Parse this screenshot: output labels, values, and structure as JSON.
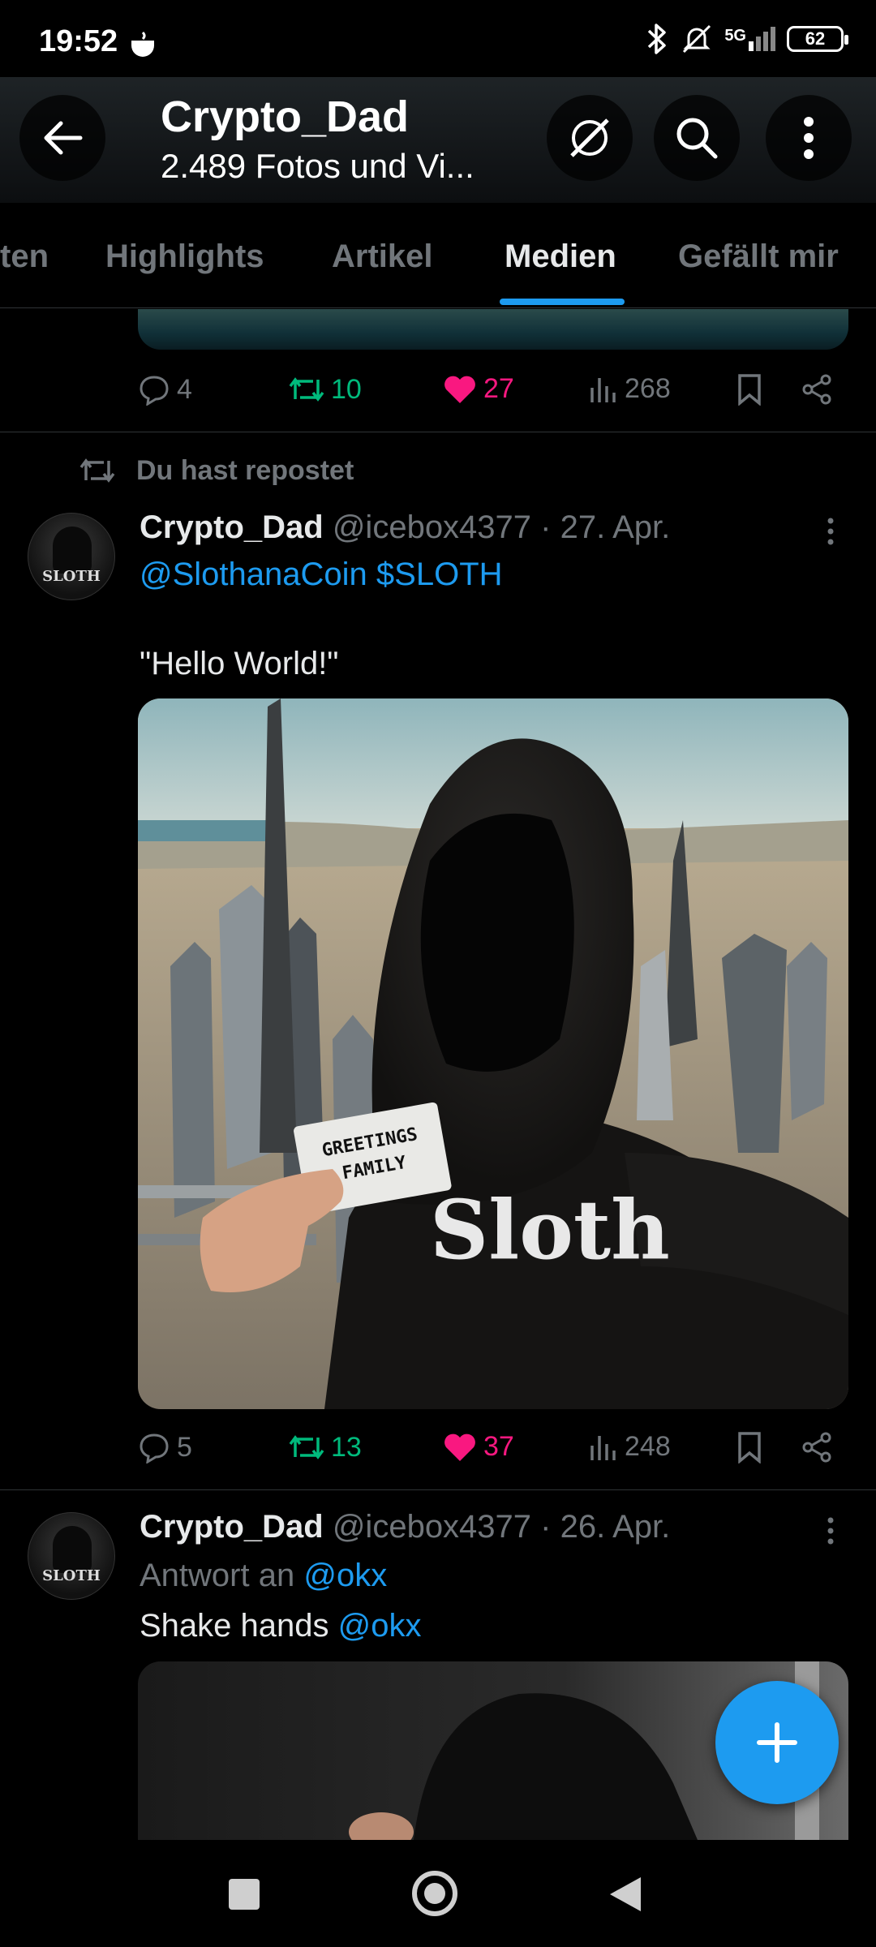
{
  "status_bar": {
    "time": "19:52",
    "network": "5G",
    "battery": "62",
    "icons": [
      "coffee-icon",
      "bluetooth-icon",
      "mute-bell-icon",
      "signal-icon",
      "battery-icon"
    ]
  },
  "header": {
    "profile_name": "Crypto_Dad",
    "subtitle": "2.489 Fotos und Vi...",
    "icons": [
      "back-arrow-icon",
      "grok-icon",
      "search-icon",
      "more-vertical-icon"
    ]
  },
  "tabs": {
    "items": [
      "ten",
      "Highlights",
      "Artikel",
      "Medien",
      "Gefällt mir"
    ],
    "active": "Medien"
  },
  "tweet0": {
    "replies": "4",
    "retweets": "10",
    "likes": "27",
    "views": "268"
  },
  "tweet1": {
    "repost_label": "Du hast repostet",
    "name": "Crypto_Dad",
    "meta": "@icebox4377 · 27. Apr.",
    "mention": "@SlothanaCoin",
    "cashtag": "$SLOTH",
    "text": "\"Hello World!\"",
    "image_sign_text": "GREETINGS FAMILY",
    "image_hoodie_text": "Sloth",
    "replies": "5",
    "retweets": "13",
    "likes": "37",
    "views": "248"
  },
  "tweet2": {
    "name": "Crypto_Dad",
    "meta": "@icebox4377 · 26. Apr.",
    "reply_prefix": "Antwort an",
    "reply_to": "@okx",
    "text_prefix": "Shake hands",
    "text_mention": "@okx"
  },
  "avatar_text": "SLOTH",
  "colors": {
    "background": "#000000",
    "accent_blue": "#1d9bf0",
    "retweet_green": "#00ba7c",
    "like_pink": "#f91880",
    "muted_gray": "#71767b"
  }
}
